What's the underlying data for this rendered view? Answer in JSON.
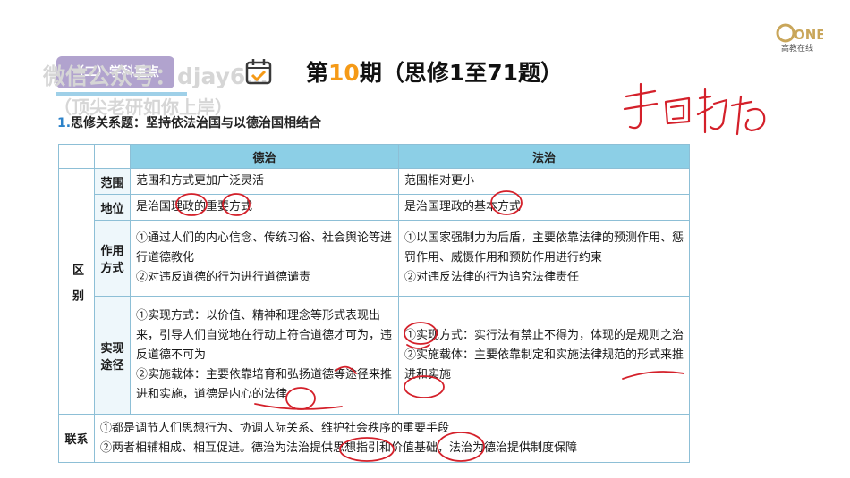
{
  "badge": {
    "label": "（二）学科重点"
  },
  "watermark": {
    "line1": "微信公众号：djay6…",
    "line2": "（顶尖老研如你上岸）"
  },
  "title": {
    "prefix": "第",
    "number": "10",
    "suffix": "期（思修1至71题）"
  },
  "logo": {
    "brand": "ONE",
    "sub": "高教在线"
  },
  "section": {
    "index": "1.",
    "text": "思修关系题：坚持依法治国与以德治国相结合"
  },
  "table": {
    "header": {
      "deyi": "德治",
      "fazhi": "法治"
    },
    "group_label": "区别",
    "rows": [
      {
        "label": "范围",
        "deyi": "范围和方式更加广泛灵活",
        "fazhi": "范围相对更小"
      },
      {
        "label": "地位",
        "deyi": "是治国理政的重要方式",
        "fazhi": "是治国理政的基本方式"
      },
      {
        "label": "作用方式",
        "deyi": [
          "①通过人们的内心信念、传统习俗、社会舆论等进行道德教化",
          "②对违反道德的行为进行道德谴责"
        ],
        "fazhi": [
          "①以国家强制力为后盾，主要依靠法律的预测作用、惩罚作用、威慑作用和预防作用进行约束",
          "②对违反法律的行为追究法律责任"
        ]
      },
      {
        "label": "实现途径",
        "deyi": [
          "①实现方式：以价值、精神和理念等形式表现出来，引导人们自觉地在行动上符合道德才可为，违反道德不可为",
          "②实施载体：主要依靠培育和弘扬道德等途径来推进和实施，道德是内心的法律"
        ],
        "fazhi": [
          "①实现方式：实行法有禁止不得为，体现的是规则之治",
          "②实施载体：主要依靠制定和实施法律规范的形式来推进和实施"
        ]
      }
    ],
    "lianxi": {
      "label": "联系",
      "lines": [
        "①都是调节人们思想行为、协调人际关系、维护社会秩序的重要手段",
        "②两者相辅相成、相互促进。德治为法治提供思想指引和价值基础，法治为德治提供制度保障"
      ]
    }
  },
  "colors": {
    "header_bg": "#8ccfe6",
    "badge_bg": "#a99ac9",
    "accent": "#f59a17",
    "ink": "#d4202a"
  },
  "icons": {
    "title": "calendar-check-icon",
    "logo": "one-logo-icon"
  }
}
